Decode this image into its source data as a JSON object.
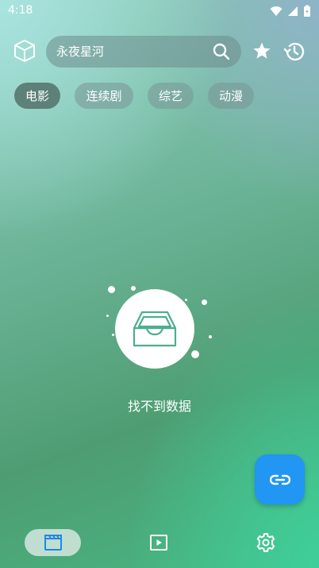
{
  "status_bar": {
    "time": "4:18"
  },
  "search": {
    "placeholder": "永夜星河"
  },
  "categories": [
    {
      "label": "电影"
    },
    {
      "label": "连续剧"
    },
    {
      "label": "综艺"
    },
    {
      "label": "动漫"
    }
  ],
  "empty_state": {
    "text": "找不到数据"
  },
  "colors": {
    "fab": "#2196f3",
    "active_chip": "#5d8078",
    "nav_icon_active": "#1e88e5",
    "empty_icon": "#4caf8c"
  },
  "icons": {
    "top_left": "cube-icon",
    "search": "search-icon",
    "favorites": "star-icon",
    "history": "history-icon",
    "fab": "link-icon",
    "nav": [
      "clapperboard-icon",
      "play-icon",
      "gear-icon"
    ]
  }
}
